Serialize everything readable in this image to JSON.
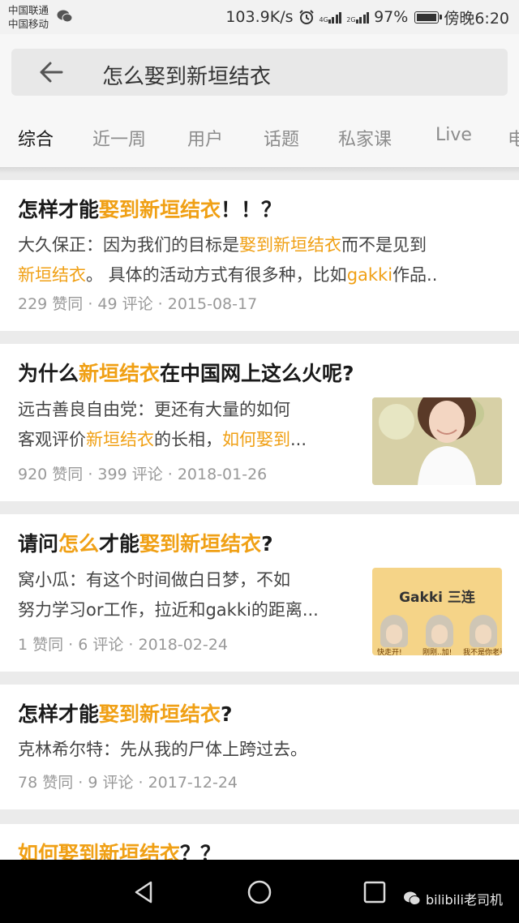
{
  "status_bar": {
    "carrier_1": "中国联通",
    "carrier_2": "中国移动",
    "speed": "103.9K/s",
    "net_1": "4G",
    "net_2": "2G",
    "battery": "97%",
    "time": "傍晚6:20"
  },
  "search": {
    "query": "怎么娶到新垣结衣"
  },
  "tabs": [
    "综合",
    "近一周",
    "用户",
    "话题",
    "私家课",
    "Live",
    "电"
  ],
  "active_tab": "综合",
  "results": [
    {
      "title": [
        {
          "t": "怎样才能",
          "hl": false
        },
        {
          "t": "娶到新垣结衣",
          "hl": true
        },
        {
          "t": "！！？",
          "hl": false
        }
      ],
      "body": [
        [
          {
            "t": "大久保正：因为我们的目标是",
            "hl": false
          },
          {
            "t": "娶到新垣结衣",
            "hl": true
          },
          {
            "t": "而不是见到",
            "hl": false
          }
        ],
        [
          {
            "t": "新垣结衣",
            "hl": true
          },
          {
            "t": "。 具体的活动方式有很多种，比如",
            "hl": false
          },
          {
            "t": "gakki",
            "hl": true
          },
          {
            "t": "作品..",
            "hl": false
          }
        ]
      ],
      "meta": "229 赞同 · 49 评论 · 2015-08-17"
    },
    {
      "title": [
        {
          "t": "为什么",
          "hl": false
        },
        {
          "t": "新垣结衣",
          "hl": true
        },
        {
          "t": "在中国网上这么火呢?",
          "hl": false
        }
      ],
      "body": [
        [
          {
            "t": "远古善良自由党：更还有大量的如何",
            "hl": false
          }
        ],
        [
          {
            "t": "客观评价",
            "hl": false
          },
          {
            "t": "新垣结衣",
            "hl": true
          },
          {
            "t": "的长相，",
            "hl": false
          },
          {
            "t": "如何娶到",
            "hl": true
          },
          {
            "t": "...",
            "hl": false
          }
        ]
      ],
      "meta": "920 赞同 · 399 评论 · 2018-01-26",
      "thumb": "photo"
    },
    {
      "title": [
        {
          "t": "请问",
          "hl": false
        },
        {
          "t": "怎么",
          "hl": true
        },
        {
          "t": "才能",
          "hl": false
        },
        {
          "t": "娶到新垣结衣",
          "hl": true
        },
        {
          "t": "?",
          "hl": false
        }
      ],
      "body": [
        [
          {
            "t": "窝小瓜：有这个时间做白日梦，不如",
            "hl": false
          }
        ],
        [
          {
            "t": "努力学习or工作，拉近和gakki的距离...",
            "hl": false
          }
        ]
      ],
      "meta": "1 赞同 · 6 评论 · 2018-02-24",
      "thumb": "gakki",
      "thumb_title": "Gakki 三连",
      "thumb_captions": [
        "快走开!",
        "刚刚..加!",
        "我不是你老婆"
      ]
    },
    {
      "title": [
        {
          "t": "怎样才能",
          "hl": false
        },
        {
          "t": "娶到新垣结衣",
          "hl": true
        },
        {
          "t": "?",
          "hl": false
        }
      ],
      "body": [
        [
          {
            "t": "克林希尔特：先从我的尸体上跨过去。",
            "hl": false
          }
        ]
      ],
      "meta": "78 赞同 · 9 评论 · 2017-12-24"
    },
    {
      "title": [
        {
          "t": "如何娶到新垣结衣",
          "hl": true
        },
        {
          "t": "？？",
          "hl": false
        }
      ],
      "body": [],
      "meta": ""
    }
  ],
  "nav": {
    "watermark": "bilibili老司机"
  },
  "colors": {
    "highlight": "#f0a015",
    "meta": "#999999",
    "background": "#ebebeb"
  }
}
